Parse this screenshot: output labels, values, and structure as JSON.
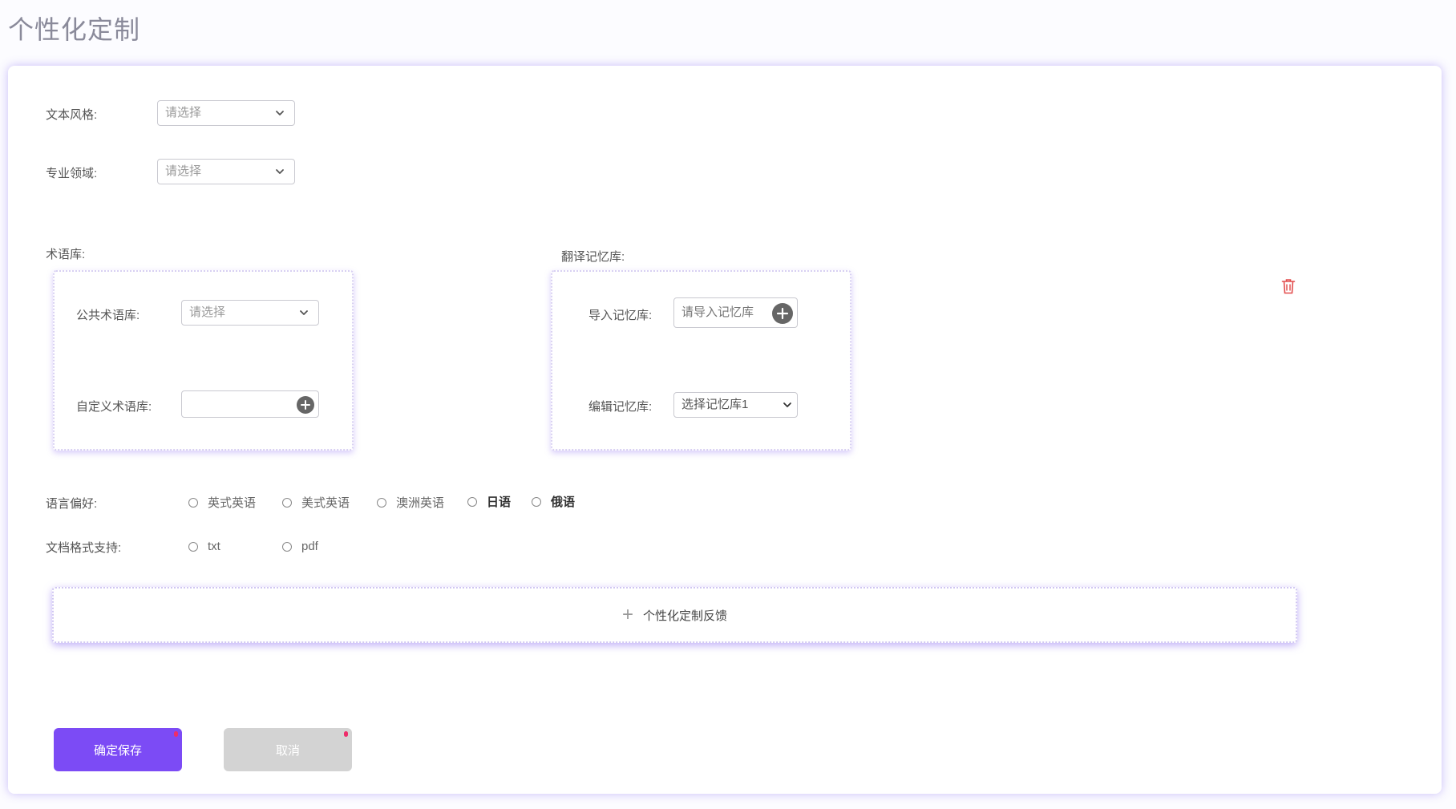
{
  "page": {
    "title": "个性化定制"
  },
  "form": {
    "text_style": {
      "label": "文本风格:",
      "placeholder": "请选择"
    },
    "domain": {
      "label": "专业领域:",
      "placeholder": "请选择"
    },
    "terminology": {
      "section_label": "术语库:",
      "public": {
        "label": "公共术语库:",
        "placeholder": "请选择"
      },
      "custom": {
        "label": "自定义术语库:",
        "value": ""
      }
    },
    "memory": {
      "section_label": "翻译记忆库:",
      "import": {
        "label": "导入记忆库:",
        "placeholder": "请导入记忆库"
      },
      "edit": {
        "label": "编辑记忆库:",
        "selected": "选择记忆库1"
      }
    },
    "language_pref": {
      "label": "语言偏好:",
      "options": [
        "英式英语",
        "美式英语",
        "澳洲英语",
        "日语",
        "俄语"
      ]
    },
    "doc_format": {
      "label": "文档格式支持:",
      "options": [
        "txt",
        "pdf"
      ]
    },
    "feedback": {
      "label": "个性化定制反馈"
    },
    "actions": {
      "save": "确定保存",
      "cancel": "取消"
    }
  },
  "colors": {
    "accent": "#7c4bf5",
    "delete": "#e24b4b",
    "cancel_bg": "#d3d3d3"
  },
  "icons": {
    "chevron": "chevron-down-icon",
    "add": "plus-circle-icon",
    "delete": "trash-icon",
    "feedback_add": "plus-icon"
  }
}
